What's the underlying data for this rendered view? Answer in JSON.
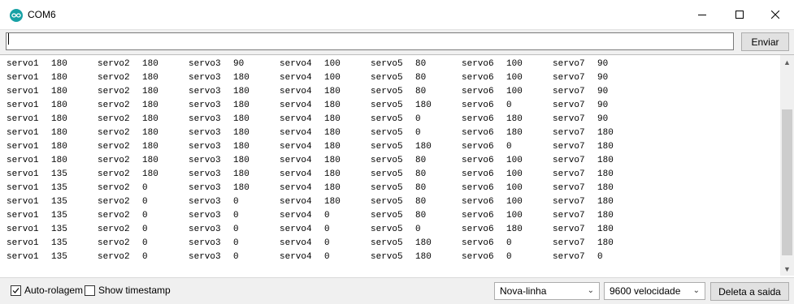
{
  "window": {
    "title": "COM6"
  },
  "send": {
    "input_value": "",
    "button_label": "Enviar"
  },
  "output_lines": [
    [
      "servo1",
      "180",
      "servo2",
      "180",
      "servo3",
      "90",
      "servo4",
      "100",
      "servo5",
      "80",
      "servo6",
      "100",
      "servo7",
      "90"
    ],
    [
      "servo1",
      "180",
      "servo2",
      "180",
      "servo3",
      "180",
      "servo4",
      "100",
      "servo5",
      "80",
      "servo6",
      "100",
      "servo7",
      "90"
    ],
    [
      "servo1",
      "180",
      "servo2",
      "180",
      "servo3",
      "180",
      "servo4",
      "180",
      "servo5",
      "80",
      "servo6",
      "100",
      "servo7",
      "90"
    ],
    [
      "servo1",
      "180",
      "servo2",
      "180",
      "servo3",
      "180",
      "servo4",
      "180",
      "servo5",
      "180",
      "servo6",
      "0",
      "servo7",
      "90"
    ],
    [
      "servo1",
      "180",
      "servo2",
      "180",
      "servo3",
      "180",
      "servo4",
      "180",
      "servo5",
      "0",
      "servo6",
      "180",
      "servo7",
      "90"
    ],
    [
      "servo1",
      "180",
      "servo2",
      "180",
      "servo3",
      "180",
      "servo4",
      "180",
      "servo5",
      "0",
      "servo6",
      "180",
      "servo7",
      "180"
    ],
    [
      "servo1",
      "180",
      "servo2",
      "180",
      "servo3",
      "180",
      "servo4",
      "180",
      "servo5",
      "180",
      "servo6",
      "0",
      "servo7",
      "180"
    ],
    [
      "servo1",
      "180",
      "servo2",
      "180",
      "servo3",
      "180",
      "servo4",
      "180",
      "servo5",
      "80",
      "servo6",
      "100",
      "servo7",
      "180"
    ],
    [
      "servo1",
      "135",
      "servo2",
      "180",
      "servo3",
      "180",
      "servo4",
      "180",
      "servo5",
      "80",
      "servo6",
      "100",
      "servo7",
      "180"
    ],
    [
      "servo1",
      "135",
      "servo2",
      "0",
      "servo3",
      "180",
      "servo4",
      "180",
      "servo5",
      "80",
      "servo6",
      "100",
      "servo7",
      "180"
    ],
    [
      "servo1",
      "135",
      "servo2",
      "0",
      "servo3",
      "0",
      "servo4",
      "180",
      "servo5",
      "80",
      "servo6",
      "100",
      "servo7",
      "180"
    ],
    [
      "servo1",
      "135",
      "servo2",
      "0",
      "servo3",
      "0",
      "servo4",
      "0",
      "servo5",
      "80",
      "servo6",
      "100",
      "servo7",
      "180"
    ],
    [
      "servo1",
      "135",
      "servo2",
      "0",
      "servo3",
      "0",
      "servo4",
      "0",
      "servo5",
      "0",
      "servo6",
      "180",
      "servo7",
      "180"
    ],
    [
      "servo1",
      "135",
      "servo2",
      "0",
      "servo3",
      "0",
      "servo4",
      "0",
      "servo5",
      "180",
      "servo6",
      "0",
      "servo7",
      "180"
    ],
    [
      "servo1",
      "135",
      "servo2",
      "0",
      "servo3",
      "0",
      "servo4",
      "0",
      "servo5",
      "180",
      "servo6",
      "0",
      "servo7",
      "0"
    ]
  ],
  "footer": {
    "autoscroll_label": "Auto-rolagem",
    "autoscroll_checked": true,
    "timestamp_label": "Show timestamp",
    "timestamp_checked": false,
    "line_ending": "Nova-linha",
    "baud_rate": "9600 velocidade",
    "clear_label": "Deleta a saida"
  },
  "icons": {
    "app": "arduino-infinity-icon",
    "minimize": "minimize-icon",
    "maximize": "maximize-icon",
    "close": "close-icon"
  },
  "colors": {
    "app_icon": "#17a1a5"
  }
}
